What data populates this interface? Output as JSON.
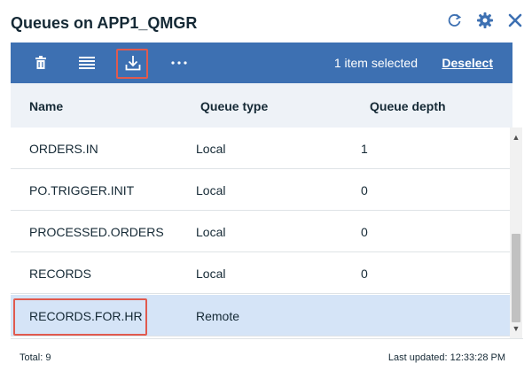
{
  "widget": {
    "title": "Queues on APP1_QMGR",
    "header_icons": [
      "refresh-icon",
      "gear-icon",
      "close-icon"
    ],
    "accent_color": "#3d70b2",
    "highlight_color": "#e05a4e"
  },
  "toolbar": {
    "buttons": [
      "trash-icon",
      "list-icon",
      "download-icon",
      "more-icon"
    ],
    "selection_text": "1 item selected",
    "deselect_label": "Deselect"
  },
  "table": {
    "columns": [
      "Name",
      "Queue type",
      "Queue depth"
    ],
    "rows": [
      {
        "name": "ORDERS.IN",
        "type": "Local",
        "depth": "1"
      },
      {
        "name": "PO.TRIGGER.INIT",
        "type": "Local",
        "depth": "0"
      },
      {
        "name": "PROCESSED.ORDERS",
        "type": "Local",
        "depth": "0"
      },
      {
        "name": "RECORDS",
        "type": "Local",
        "depth": "0"
      },
      {
        "name": "RECORDS.FOR.HR",
        "type": "Remote",
        "depth": ""
      }
    ],
    "selected_row": 4
  },
  "footer": {
    "total": "Total: 9",
    "last_updated": "Last updated: 12:33:28 PM"
  }
}
